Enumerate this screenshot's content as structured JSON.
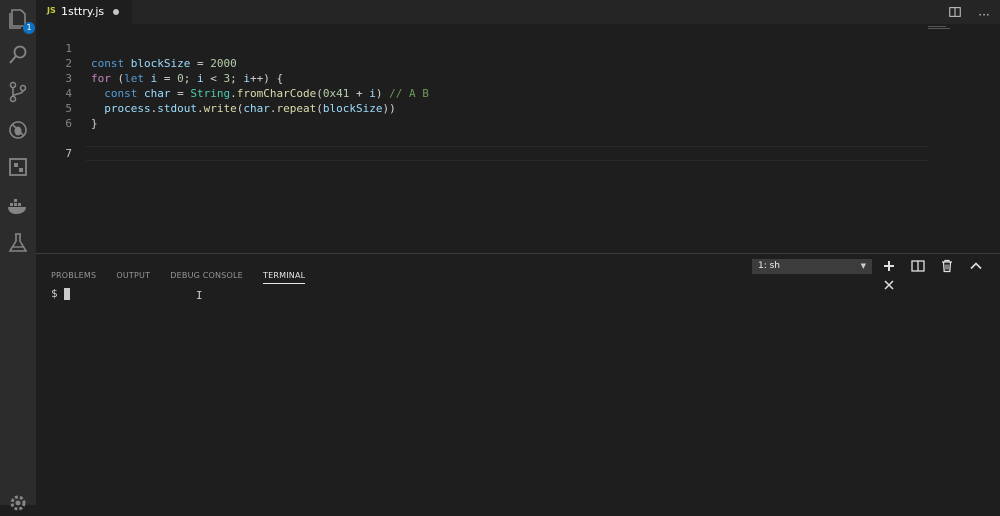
{
  "activity_bar": {
    "icons": [
      "files-icon",
      "search-icon",
      "source-control-icon",
      "debug-icon",
      "extensions-icon",
      "docker-icon",
      "test-flask-icon",
      "gear-icon"
    ],
    "explorer_badge": "1"
  },
  "tab": {
    "lang": "JS",
    "filename": "1sttry.js"
  },
  "editor": {
    "line_numbers": [
      "1",
      "2",
      "3",
      "4",
      "5",
      "6",
      "7"
    ],
    "lines": [
      "const blockSize = 2000",
      "for (let i = 0; i < 3; i++) {",
      "  const char = String.fromCharCode(0x41 + i) // A B",
      "  process.stdout.write(char.repeat(blockSize))",
      "}",
      "",
      ""
    ],
    "current_line": "7"
  },
  "panel": {
    "tabs": [
      "PROBLEMS",
      "OUTPUT",
      "DEBUG CONSOLE",
      "TERMINAL"
    ],
    "active_tab": "TERMINAL",
    "terminal_select": "1: sh",
    "prompt": "$"
  },
  "colors": {
    "background": "#1e1e1e",
    "activity_bar": "#2c2c2c",
    "badge": "#0e70c0",
    "keyword": "#569cd6",
    "control_keyword": "#c586c0",
    "variable": "#9cdcfe",
    "number": "#b5cea8",
    "class": "#4ec9b0",
    "function": "#dcdcaa",
    "comment": "#6a9955"
  }
}
